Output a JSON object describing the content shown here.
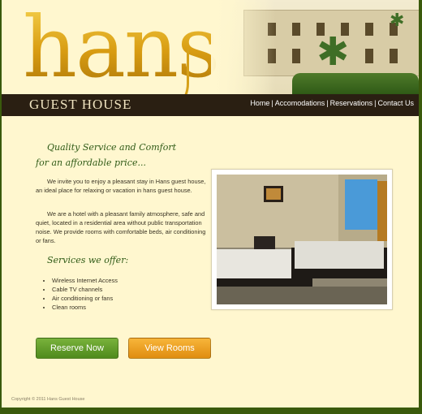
{
  "header": {
    "logo_script": "hans",
    "logo_subtitle": "GUEST HOUSE",
    "nav": [
      "Home",
      "Accomodations",
      "Reservations",
      "Contact Us"
    ]
  },
  "intro": {
    "tagline_line1": "Quality Service and Comfort",
    "tagline_line2": "for an affordable price...",
    "paragraph1": "We invite you to enjoy a pleasant stay in Hans guest house, an ideal place for relaxing or vacation in hans guest house.",
    "paragraph2": "We are a hotel with a pleasant family atmosphere, safe and quiet, located in a residential area without public transportation noise. We provide rooms with comfortable beds, air conditioning or fans."
  },
  "services": {
    "title": "Services we offer:",
    "items": [
      "Wireless Internet Access",
      "Cable TV channels",
      "Air conditioning or fans",
      "Clean rooms"
    ]
  },
  "buttons": {
    "reserve": "Reserve Now",
    "view_rooms": "View Rooms"
  },
  "footer": {
    "copyright": "Copyright © 2011 Hans Guest House"
  },
  "colors": {
    "page_bg": "#fff7cf",
    "outer_bg": "#3a5a0c",
    "band": "#2a1f12",
    "accent_green": "#2f5a16",
    "gold": "#d89c12",
    "reserve_button": "#5f9a28",
    "view_button": "#eda020"
  }
}
